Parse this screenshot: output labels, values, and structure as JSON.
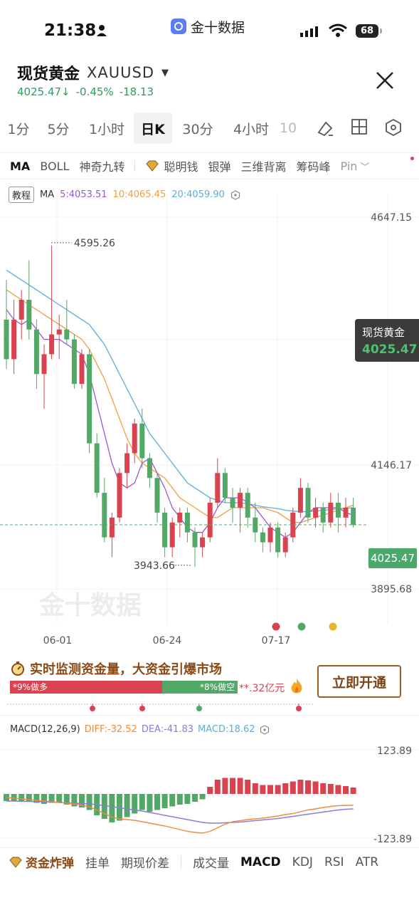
{
  "status_bar": {
    "time": "21:38",
    "app_name": "金十数据",
    "battery": "68"
  },
  "header": {
    "title": "现货黄金",
    "symbol": "XAUUSD",
    "price": "4025.47",
    "arrow": "↓",
    "change_pct": "-0.45%",
    "change_abs": "-18.13"
  },
  "periods": [
    "1分",
    "5分",
    "1小时",
    "日K",
    "30分",
    "4小时",
    "10"
  ],
  "active_period": "日K",
  "indicators": [
    "MA",
    "BOLL",
    "神奇九转",
    "聪明钱",
    "银弹",
    "三维背离",
    "筹码峰",
    "Pin"
  ],
  "chart": {
    "tutorial_label": "教程",
    "ma_label": "MA",
    "ma5": "5:4053.51",
    "ma10": "10:4065.45",
    "ma20": "20:4059.90",
    "callout_name": "现货黄金",
    "callout_price": "4025.47",
    "current_price_tag": "4025.47",
    "watermark": "金十数据",
    "colors": {
      "up": "#d9434f",
      "down": "#52a866",
      "ma5": "#9b59d0",
      "ma10": "#f0a040",
      "ma20": "#5aaed8"
    }
  },
  "chart_data": {
    "type": "candlestick",
    "y_axis_labels": [
      "4647.15",
      "4146.17",
      "3895.68"
    ],
    "x_axis_labels": [
      "06-01",
      "06-24",
      "07-17"
    ],
    "annotations": {
      "high": "4595.26",
      "low": "3943.66"
    },
    "current": "4025.47",
    "candles": [
      {
        "o": 4440,
        "h": 4520,
        "l": 4340,
        "c": 4360
      },
      {
        "o": 4360,
        "h": 4480,
        "l": 4330,
        "c": 4440
      },
      {
        "o": 4440,
        "h": 4500,
        "l": 4400,
        "c": 4480
      },
      {
        "o": 4480,
        "h": 4560,
        "l": 4400,
        "c": 4420
      },
      {
        "o": 4420,
        "h": 4440,
        "l": 4300,
        "c": 4330
      },
      {
        "o": 4330,
        "h": 4390,
        "l": 4260,
        "c": 4370
      },
      {
        "o": 4370,
        "h": 4590,
        "l": 4360,
        "c": 4410
      },
      {
        "o": 4410,
        "h": 4450,
        "l": 4360,
        "c": 4420
      },
      {
        "o": 4420,
        "h": 4480,
        "l": 4390,
        "c": 4400
      },
      {
        "o": 4400,
        "h": 4410,
        "l": 4300,
        "c": 4310
      },
      {
        "o": 4310,
        "h": 4380,
        "l": 4300,
        "c": 4370
      },
      {
        "o": 4370,
        "h": 4380,
        "l": 4170,
        "c": 4190
      },
      {
        "o": 4190,
        "h": 4210,
        "l": 4080,
        "c": 4090
      },
      {
        "o": 4090,
        "h": 4120,
        "l": 3990,
        "c": 4000
      },
      {
        "o": 4000,
        "h": 4050,
        "l": 3960,
        "c": 4040
      },
      {
        "o": 4040,
        "h": 4140,
        "l": 4030,
        "c": 4130
      },
      {
        "o": 4130,
        "h": 4190,
        "l": 4100,
        "c": 4170
      },
      {
        "o": 4170,
        "h": 4240,
        "l": 4150,
        "c": 4230
      },
      {
        "o": 4230,
        "h": 4260,
        "l": 4140,
        "c": 4160
      },
      {
        "o": 4160,
        "h": 4170,
        "l": 4100,
        "c": 4120
      },
      {
        "o": 4120,
        "h": 4130,
        "l": 4030,
        "c": 4050
      },
      {
        "o": 4050,
        "h": 4060,
        "l": 3960,
        "c": 3980
      },
      {
        "o": 3980,
        "h": 4040,
        "l": 3960,
        "c": 4030
      },
      {
        "o": 4030,
        "h": 4060,
        "l": 4000,
        "c": 4050
      },
      {
        "o": 4050,
        "h": 4060,
        "l": 3990,
        "c": 4010
      },
      {
        "o": 4010,
        "h": 4020,
        "l": 3940,
        "c": 3980
      },
      {
        "o": 3980,
        "h": 4010,
        "l": 3960,
        "c": 4000
      },
      {
        "o": 4000,
        "h": 4080,
        "l": 3990,
        "c": 4070
      },
      {
        "o": 4070,
        "h": 4160,
        "l": 4060,
        "c": 4130
      },
      {
        "o": 4130,
        "h": 4140,
        "l": 4070,
        "c": 4080
      },
      {
        "o": 4080,
        "h": 4100,
        "l": 4030,
        "c": 4060
      },
      {
        "o": 4060,
        "h": 4100,
        "l": 4010,
        "c": 4090
      },
      {
        "o": 4090,
        "h": 4100,
        "l": 4020,
        "c": 4040
      },
      {
        "o": 4040,
        "h": 4070,
        "l": 3990,
        "c": 4010
      },
      {
        "o": 4010,
        "h": 4020,
        "l": 3970,
        "c": 3990
      },
      {
        "o": 3990,
        "h": 4030,
        "l": 3970,
        "c": 4020
      },
      {
        "o": 4020,
        "h": 4030,
        "l": 3960,
        "c": 3970
      },
      {
        "o": 3970,
        "h": 4010,
        "l": 3960,
        "c": 4000
      },
      {
        "o": 4000,
        "h": 4060,
        "l": 3990,
        "c": 4050
      },
      {
        "o": 4050,
        "h": 4120,
        "l": 4040,
        "c": 4100
      },
      {
        "o": 4100,
        "h": 4110,
        "l": 4030,
        "c": 4040
      },
      {
        "o": 4040,
        "h": 4080,
        "l": 4020,
        "c": 4060
      },
      {
        "o": 4060,
        "h": 4070,
        "l": 4010,
        "c": 4030
      },
      {
        "o": 4030,
        "h": 4090,
        "l": 4020,
        "c": 4070
      },
      {
        "o": 4070,
        "h": 4090,
        "l": 4010,
        "c": 4040
      },
      {
        "o": 4040,
        "h": 4080,
        "l": 4020,
        "c": 4060
      },
      {
        "o": 4060,
        "h": 4080,
        "l": 4020,
        "c": 4025
      }
    ],
    "ma5": [
      4460,
      4440,
      4430,
      4440,
      4420,
      4400,
      4400,
      4400,
      4390,
      4380,
      4370,
      4330,
      4270,
      4210,
      4150,
      4110,
      4100,
      4110,
      4150,
      4160,
      4130,
      4100,
      4060,
      4040,
      4020,
      4010,
      4010,
      4030,
      4060,
      4080,
      4080,
      4080,
      4070,
      4060,
      4040,
      4020,
      4010,
      4000,
      4010,
      4030,
      4050,
      4060,
      4060,
      4060,
      4060,
      4050,
      4045
    ],
    "ma10": [
      4500,
      4490,
      4480,
      4470,
      4460,
      4450,
      4440,
      4430,
      4420,
      4410,
      4400,
      4380,
      4350,
      4320,
      4280,
      4240,
      4200,
      4170,
      4150,
      4140,
      4130,
      4120,
      4100,
      4080,
      4070,
      4060,
      4050,
      4040,
      4040,
      4050,
      4060,
      4060,
      4060,
      4060,
      4060,
      4055,
      4050,
      4040,
      4030,
      4030,
      4035,
      4040,
      4045,
      4050,
      4055,
      4060,
      4065
    ],
    "ma20": [
      4540,
      4530,
      4520,
      4510,
      4500,
      4490,
      4480,
      4470,
      4460,
      4450,
      4440,
      4430,
      4410,
      4390,
      4360,
      4330,
      4300,
      4270,
      4240,
      4210,
      4190,
      4170,
      4150,
      4130,
      4110,
      4100,
      4090,
      4080,
      4075,
      4070,
      4070,
      4070,
      4068,
      4065,
      4062,
      4060,
      4058,
      4055,
      4053,
      4052,
      4052,
      4053,
      4055,
      4056,
      4058,
      4059,
      4060
    ]
  },
  "fund": {
    "title": "实时监测资金量，大资金引爆市场",
    "bull_label": "*9%做多",
    "bear_label": "*8%做空",
    "bull_share": 0.67,
    "amount": "**.32亿元",
    "button": "立即开通"
  },
  "macd": {
    "name": "MACD(12,26,9)",
    "diff": "DIFF:-32.52",
    "dea": "DEA:-41.83",
    "macd": "MACD:18.62",
    "top_label": "123.89",
    "bottom_label": "-123.89",
    "hist": [
      -20,
      -20,
      -20,
      -22,
      -25,
      -28,
      -25,
      -25,
      -30,
      -35,
      -38,
      -45,
      -60,
      -70,
      -80,
      -75,
      -65,
      -55,
      -45,
      -50,
      -45,
      -40,
      -35,
      -30,
      -28,
      -22,
      -15,
      20,
      40,
      45,
      45,
      45,
      40,
      30,
      25,
      25,
      25,
      30,
      35,
      40,
      38,
      35,
      30,
      28,
      25,
      22,
      18
    ],
    "diff_series": [
      -10,
      -12,
      -14,
      -16,
      -18,
      -20,
      -22,
      -24,
      -26,
      -28,
      -32,
      -36,
      -45,
      -55,
      -65,
      -70,
      -72,
      -74,
      -78,
      -82,
      -86,
      -90,
      -95,
      -100,
      -105,
      -108,
      -110,
      -105,
      -95,
      -85,
      -78,
      -75,
      -72,
      -70,
      -68,
      -65,
      -62,
      -58,
      -55,
      -50,
      -45,
      -42,
      -38,
      -35,
      -33,
      -32,
      -32
    ],
    "dea_series": [
      -20,
      -20,
      -21,
      -21,
      -22,
      -22,
      -23,
      -24,
      -25,
      -26,
      -27,
      -28,
      -30,
      -33,
      -36,
      -39,
      -42,
      -45,
      -48,
      -52,
      -56,
      -60,
      -64,
      -68,
      -72,
      -76,
      -80,
      -82,
      -82,
      -81,
      -80,
      -79,
      -77,
      -75,
      -73,
      -71,
      -69,
      -66,
      -63,
      -60,
      -57,
      -54,
      -51,
      -48,
      -45,
      -43,
      -42
    ]
  },
  "bottom_tabs": [
    "资金炸弹",
    "挂单",
    "期现价差",
    "成交量",
    "MACD",
    "KDJ",
    "RSI",
    "ATR"
  ],
  "active_bottom_tab": "MACD"
}
